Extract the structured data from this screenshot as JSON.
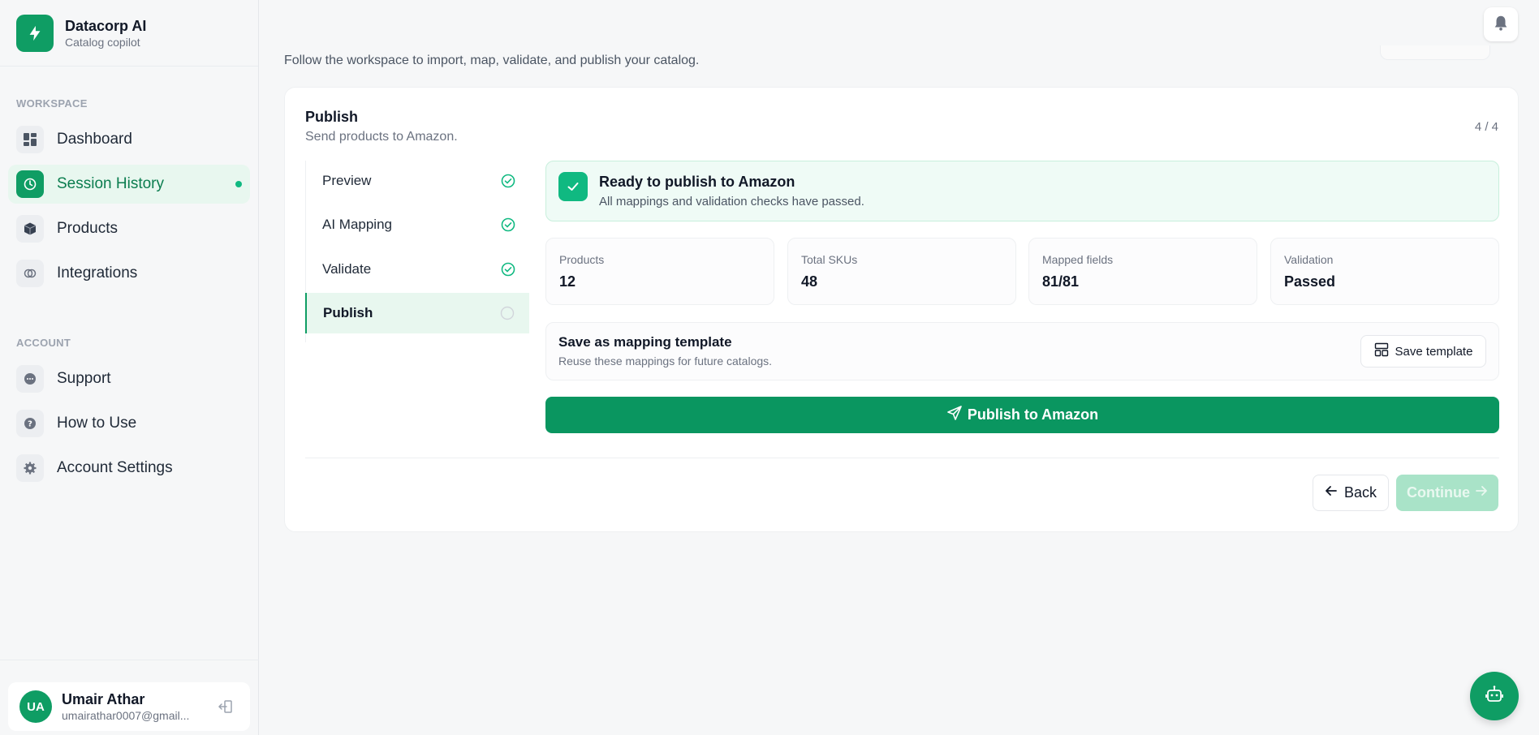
{
  "brand": {
    "name": "Datacorp AI",
    "subtitle": "Catalog copilot",
    "logo_icon": "bolt-icon",
    "accent": "#0f9d64"
  },
  "sidebar": {
    "workspace_label": "WORKSPACE",
    "account_label": "ACCOUNT",
    "workspace_items": [
      {
        "label": "Dashboard",
        "icon": "dashboard-icon",
        "active": false
      },
      {
        "label": "Session History",
        "icon": "history-icon",
        "active": true
      },
      {
        "label": "Products",
        "icon": "box-icon",
        "active": false
      },
      {
        "label": "Integrations",
        "icon": "link-icon",
        "active": false
      }
    ],
    "account_items": [
      {
        "label": "Support",
        "icon": "chat-icon"
      },
      {
        "label": "How to Use",
        "icon": "help-icon"
      },
      {
        "label": "Account Settings",
        "icon": "gear-icon"
      }
    ],
    "user": {
      "initials": "UA",
      "name": "Umair Athar",
      "email": "umairathar0007@gmail..."
    }
  },
  "header": {
    "subtitle": "Follow the workspace to import, map, validate, and publish your catalog."
  },
  "card": {
    "title": "Publish",
    "subtitle": "Send products to Amazon.",
    "step_count": "4 / 4",
    "steps": [
      {
        "label": "Preview",
        "done": true
      },
      {
        "label": "AI Mapping",
        "done": true
      },
      {
        "label": "Validate",
        "done": true
      },
      {
        "label": "Publish",
        "done": false,
        "active": true
      }
    ],
    "ready": {
      "title": "Ready to publish to Amazon",
      "description": "All mappings and validation checks have passed."
    },
    "stats": [
      {
        "label": "Products",
        "value": "12"
      },
      {
        "label": "Total SKUs",
        "value": "48"
      },
      {
        "label": "Mapped fields",
        "value": "81/81"
      },
      {
        "label": "Validation",
        "value": "Passed"
      }
    ],
    "template": {
      "title": "Save as mapping template",
      "description": "Reuse these mappings for future catalogs.",
      "button_label": "Save template"
    },
    "publish_button": "Publish to Amazon",
    "back_button": "Back",
    "continue_button": "Continue"
  }
}
